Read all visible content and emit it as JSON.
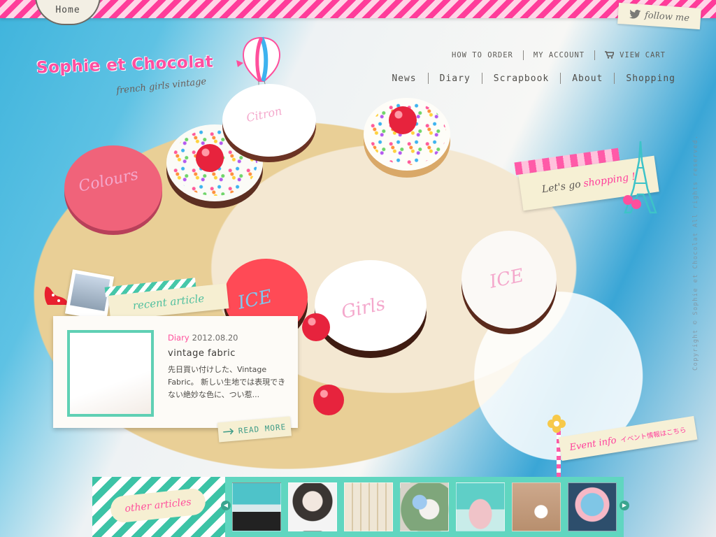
{
  "header": {
    "home_label": "Home",
    "follow_label": "follow me",
    "logo_text": "Sophie et Chocolat",
    "tagline": "french girls vintage"
  },
  "util_nav": {
    "how_to_order": "HOW TO ORDER",
    "my_account": "MY ACCOUNT",
    "view_cart": "VIEW CART"
  },
  "main_nav": [
    {
      "label": "News"
    },
    {
      "label": "Diary"
    },
    {
      "label": "Scrapbook"
    },
    {
      "label": "About"
    },
    {
      "label": "Shopping"
    }
  ],
  "cake_texts": {
    "c1": "Colours",
    "c3": "Citron",
    "c5": "ICE",
    "c6": "Girls",
    "c7": "ICE"
  },
  "shop_tag": {
    "text": "Let's go",
    "highlight": "shopping !"
  },
  "copyright": "Copyright © Sophie et Chocolat All rights reserved.",
  "recent_article": {
    "section_label": "recent article",
    "category": "Diary",
    "date": "2012.08.20",
    "title": "vintage fabric",
    "excerpt": "先日買い付けした、Vintage Fabric。 新しい生地では表現できない絶妙な色に、つい惹...",
    "read_more": "READ MORE"
  },
  "event": {
    "label_en": "Event info",
    "label_jp": "イベント情報はこちら"
  },
  "other_articles": {
    "label": "other articles",
    "thumbs": [
      "t1",
      "t2",
      "t3",
      "t4",
      "t5",
      "t6",
      "t7"
    ]
  },
  "colors": {
    "pink": "#ff3c9a",
    "mint": "#60d6c0",
    "cream": "#f6efd2",
    "sky": "#3fb4dc"
  }
}
